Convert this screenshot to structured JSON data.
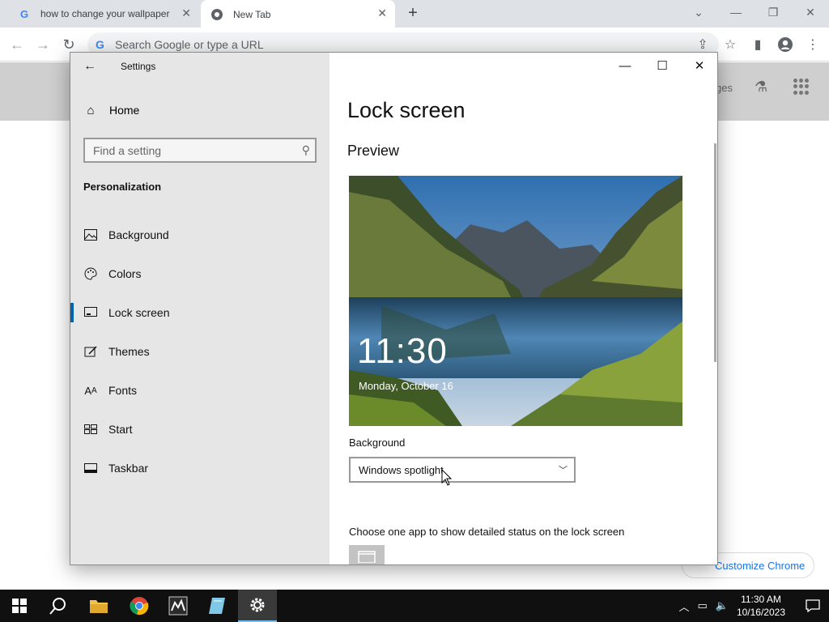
{
  "browser": {
    "tabs": [
      {
        "title": "how to change your wallpaper",
        "icon": "google-icon"
      },
      {
        "title": "New Tab",
        "icon": "chrome-icon"
      }
    ],
    "omnibox_placeholder": "Search Google or type a URL",
    "page_links": {
      "images": "ges"
    },
    "customize_label": "Customize Chrome"
  },
  "settings": {
    "window_title": "Settings",
    "home_label": "Home",
    "search_placeholder": "Find a setting",
    "category": "Personalization",
    "nav_items": [
      {
        "label": "Background",
        "icon": "picture-icon"
      },
      {
        "label": "Colors",
        "icon": "palette-icon"
      },
      {
        "label": "Lock screen",
        "icon": "lock-screen-icon",
        "active": true
      },
      {
        "label": "Themes",
        "icon": "brush-icon"
      },
      {
        "label": "Fonts",
        "icon": "font-icon"
      },
      {
        "label": "Start",
        "icon": "start-icon"
      },
      {
        "label": "Taskbar",
        "icon": "taskbar-icon"
      }
    ],
    "page_title": "Lock screen",
    "preview_heading": "Preview",
    "preview_time": "11:30",
    "preview_date": "Monday, October 16",
    "background_label": "Background",
    "background_value": "Windows spotlight",
    "status_app_text": "Choose one app to show detailed status on the lock screen",
    "accent_color": "#0063b1"
  },
  "taskbar": {
    "apps": [
      "start-icon",
      "search-icon",
      "file-explorer-icon",
      "chrome-icon",
      "app-icon",
      "notes-icon",
      "settings-icon"
    ],
    "time": "11:30 AM",
    "date": "10/16/2023"
  }
}
